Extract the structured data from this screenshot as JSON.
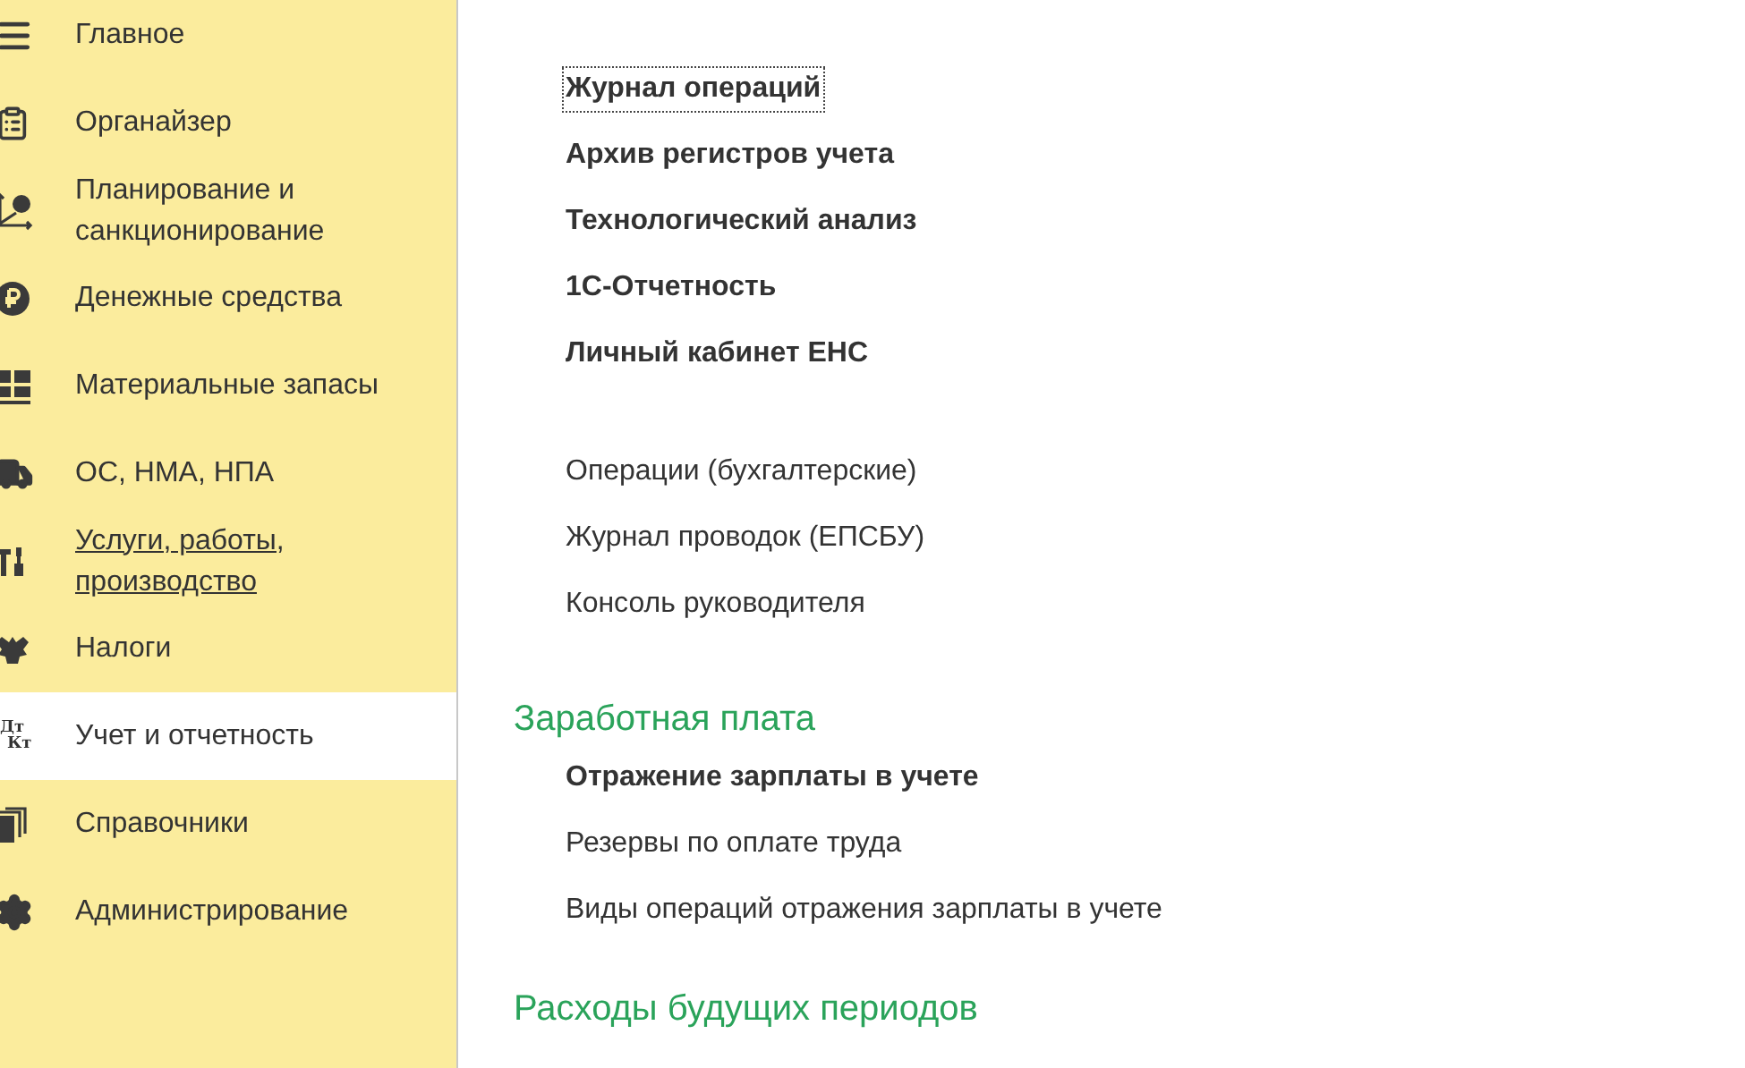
{
  "sidebar": {
    "items": [
      {
        "label": "Главное",
        "selected": false,
        "underlined": false
      },
      {
        "label": "Органайзер",
        "selected": false,
        "underlined": false
      },
      {
        "label": "Планирование и санкционирование",
        "selected": false,
        "underlined": false
      },
      {
        "label": "Денежные средства",
        "selected": false,
        "underlined": false
      },
      {
        "label": "Материальные запасы",
        "selected": false,
        "underlined": false
      },
      {
        "label": "ОС, НМА, НПА",
        "selected": false,
        "underlined": false
      },
      {
        "label": "Услуги, работы, производство",
        "selected": false,
        "underlined": true
      },
      {
        "label": "Налоги",
        "selected": false,
        "underlined": false
      },
      {
        "label": "Учет и отчетность",
        "selected": true,
        "underlined": false,
        "icon_text": [
          "Дт",
          "Кт"
        ]
      },
      {
        "label": "Справочники",
        "selected": false,
        "underlined": false
      },
      {
        "label": "Администрирование",
        "selected": false,
        "underlined": false
      }
    ]
  },
  "content": {
    "sections": [
      {
        "links": [
          {
            "label": "Журнал операций",
            "bold": true,
            "focused": true
          },
          {
            "label": "Архив регистров учета",
            "bold": true,
            "focused": false
          },
          {
            "label": "Технологический анализ",
            "bold": true,
            "focused": false
          },
          {
            "label": "1С-Отчетность",
            "bold": true,
            "focused": false
          },
          {
            "label": "Личный кабинет ЕНС",
            "bold": true,
            "focused": false
          }
        ]
      },
      {
        "links": [
          {
            "label": "Операции (бухгалтерские)",
            "bold": false,
            "focused": false
          },
          {
            "label": "Журнал проводок (ЕПСБУ)",
            "bold": false,
            "focused": false
          },
          {
            "label": "Консоль руководителя",
            "bold": false,
            "focused": false
          }
        ]
      },
      {
        "title": "Заработная плата",
        "links": [
          {
            "label": "Отражение зарплаты в учете",
            "bold": true,
            "focused": false
          },
          {
            "label": "Резервы по оплате труда",
            "bold": false,
            "focused": false
          },
          {
            "label": "Виды операций отражения зарплаты в учете",
            "bold": false,
            "focused": false
          }
        ]
      },
      {
        "title": "Расходы будущих периодов"
      }
    ]
  }
}
